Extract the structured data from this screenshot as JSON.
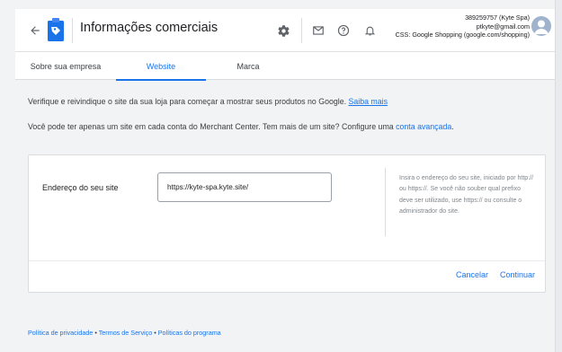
{
  "header": {
    "title": "Informações comerciais",
    "account_line1": "389259757 (Kyte Spa)",
    "account_line2": "ptkyte@gmail.com",
    "account_line3": "CSS: Google Shopping (google.com/shopping)"
  },
  "tabs": [
    {
      "label": "Sobre sua empresa",
      "active": false
    },
    {
      "label": "Website",
      "active": true
    },
    {
      "label": "Marca",
      "active": false
    }
  ],
  "intro": {
    "verify_text": "Verifique e reivindique o site da sua loja para começar a mostrar seus produtos no Google. ",
    "verify_link": "Saiba mais",
    "single_site_text": "Você pode ter apenas um site em cada conta do Merchant Center. Tem mais de um site? Configure uma ",
    "single_site_link": "conta avançada",
    "single_site_end": "."
  },
  "form": {
    "field_label": "Endereço do seu site",
    "url_value": "https://kyte-spa.kyte.site/",
    "help_text": "Insira o endereço do seu site, iniciado por http:// ou https://. Se você não souber qual prefixo deve ser utilizado, use https:// ou consulte o administrador do site.",
    "cancel_label": "Cancelar",
    "continue_label": "Continuar"
  },
  "footer": {
    "privacy": "Política de privacidade",
    "terms": "Termos de Serviço",
    "policies": "Políticas do programa",
    "separator": " • "
  },
  "colors": {
    "accent": "#1a73e8",
    "background": "#f1f3f4",
    "text": "#3c4043"
  }
}
